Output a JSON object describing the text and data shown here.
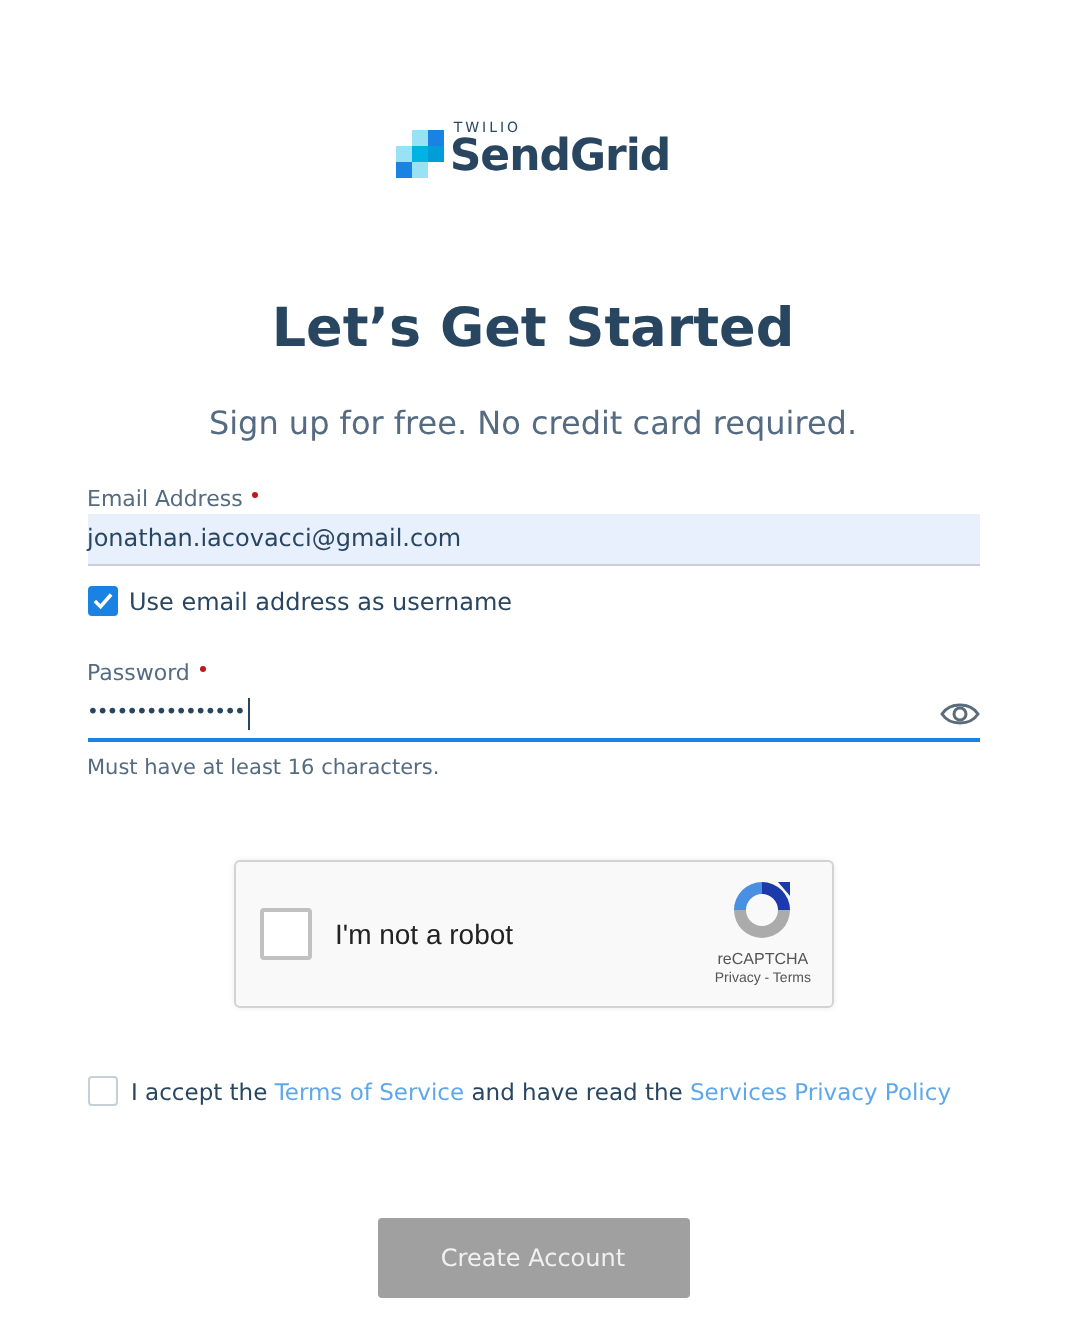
{
  "logo": {
    "overline": "TWILIO",
    "name": "SendGrid"
  },
  "heading": "Let’s Get Started",
  "subtitle": "Sign up for free. No credit card required.",
  "email": {
    "label": "Email Address",
    "required": true,
    "value": "jonathan.iacovacci@gmail.com",
    "autofilled": true
  },
  "use_email_as_username": {
    "label": "Use email address as username",
    "checked": true
  },
  "password": {
    "label": "Password",
    "required": true,
    "value": "••••••••••••••••",
    "focused": true,
    "hint": "Must have at least 16 characters."
  },
  "captcha": {
    "label": "I'm not a robot",
    "checked": false,
    "brand": "reCAPTCHA",
    "links": "Privacy - Terms"
  },
  "terms": {
    "checked": false,
    "parts": [
      {
        "kind": "text",
        "text": "I accept the "
      },
      {
        "kind": "link",
        "text": "Terms of Service"
      },
      {
        "kind": "text",
        "text": " and have read the "
      },
      {
        "kind": "link",
        "text": "Services Privacy Policy"
      }
    ]
  },
  "submit": {
    "label": "Create Account",
    "disabled": true
  }
}
